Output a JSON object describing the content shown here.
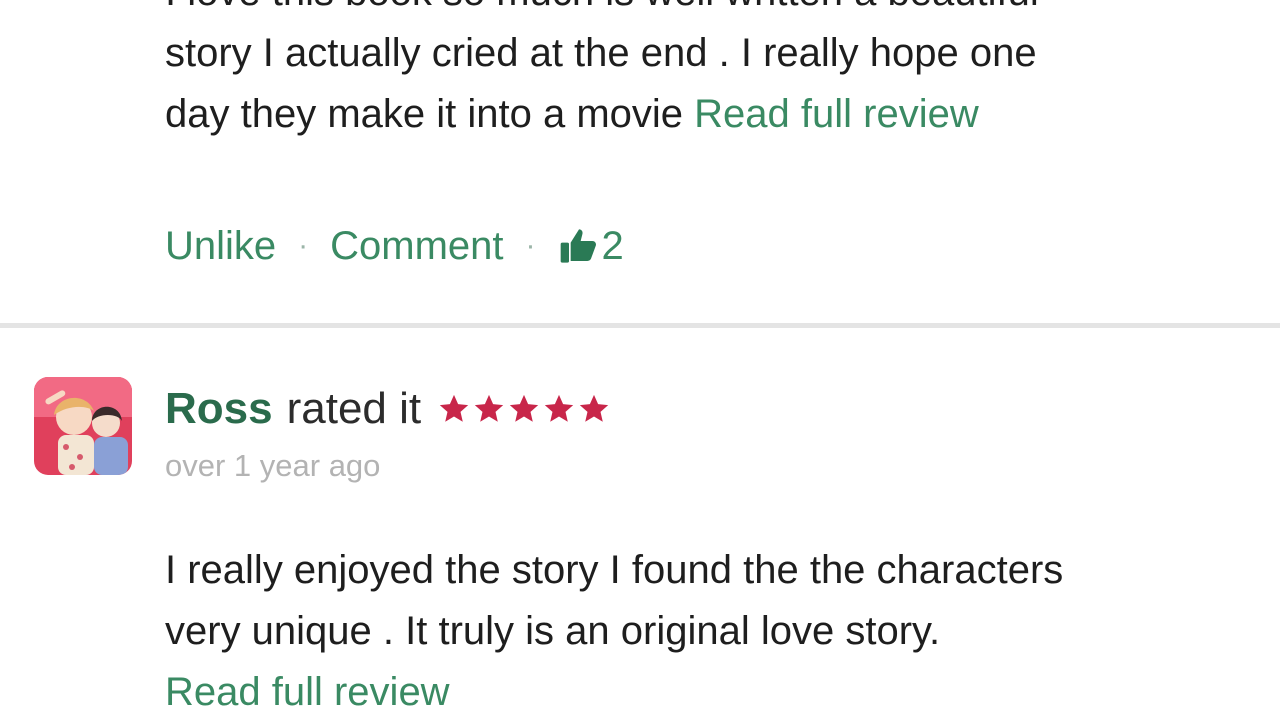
{
  "review1": {
    "lines": [
      "I love this book so much is well written a beautiful",
      "story I actually cried at the end . I really hope one",
      "day they make it into a movie "
    ],
    "read_more": "Read full review",
    "actions": {
      "unlike": "Unlike",
      "separator": "·",
      "comment": "Comment",
      "like_icon": "thumbs-up-icon",
      "like_count": "2"
    }
  },
  "review2": {
    "user": "Ross",
    "rated_label": "rated it",
    "stars": 5,
    "star_icon": "star-icon",
    "timestamp": "over 1 year ago",
    "lines": [
      "I really enjoyed the story I found the the characters",
      "very unique . It truly is an original love story."
    ],
    "read_more": "Read full review"
  },
  "colors": {
    "link_green": "#3a8a63",
    "name_green": "#2a6b4c",
    "star_red": "#c8264a",
    "timestamp_gray": "#b3b3b3",
    "divider_gray": "#e4e4e4"
  }
}
